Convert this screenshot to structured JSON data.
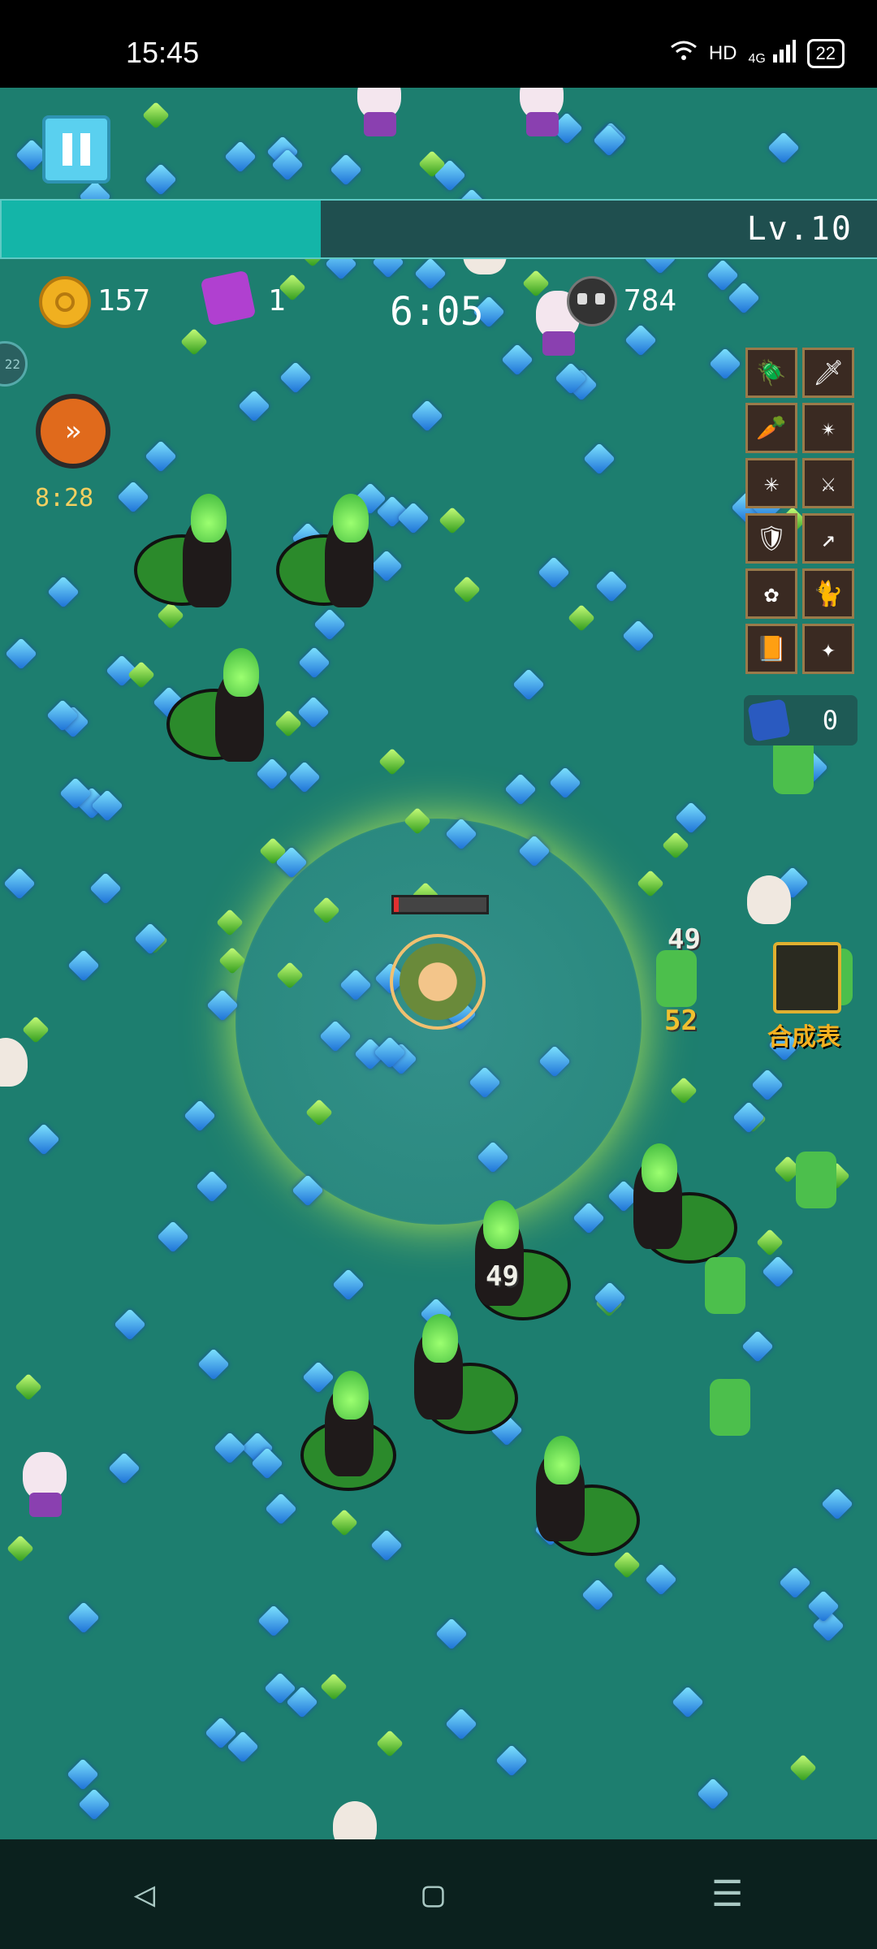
{
  "status_bar": {
    "time": "15:45",
    "network_label": "HD",
    "signal_label": "4G",
    "battery": "22",
    "icons": [
      "wifi-icon",
      "hd-icon",
      "signal-icon",
      "battery-icon"
    ]
  },
  "hud": {
    "level_label": "Lv.10",
    "xp_progress": 0.365,
    "coins": "157",
    "puzzle_pieces": "1",
    "survival_time": "6:05",
    "kills": "784",
    "left_widget_label": "22",
    "speed_timer": "8:28",
    "dice_count": "0",
    "hero_hp": 0.05
  },
  "skills": [
    {
      "icon": "beetle-icon"
    },
    {
      "icon": "green-sword-icon"
    },
    {
      "icon": "carrot-staff-icon"
    },
    {
      "icon": "burst-icon"
    },
    {
      "icon": "shatter-icon"
    },
    {
      "icon": "purple-sword-icon"
    },
    {
      "icon": "armor-icon"
    },
    {
      "icon": "spear-icon"
    },
    {
      "icon": "leaf-icon"
    },
    {
      "icon": "cat-icon"
    },
    {
      "icon": "book-icon"
    },
    {
      "icon": "star-wand-icon"
    }
  ],
  "damage_numbers": [
    "49",
    "52",
    "49"
  ],
  "craft_table": {
    "label": "合成表"
  },
  "colors": {
    "background": "#1d7e6f",
    "xp_fill": "#14b5a8",
    "timer_text": "#f5d060",
    "craft_text": "#f5b020"
  },
  "nav": {
    "back": "◁",
    "home": "▢",
    "menu": "☰"
  }
}
